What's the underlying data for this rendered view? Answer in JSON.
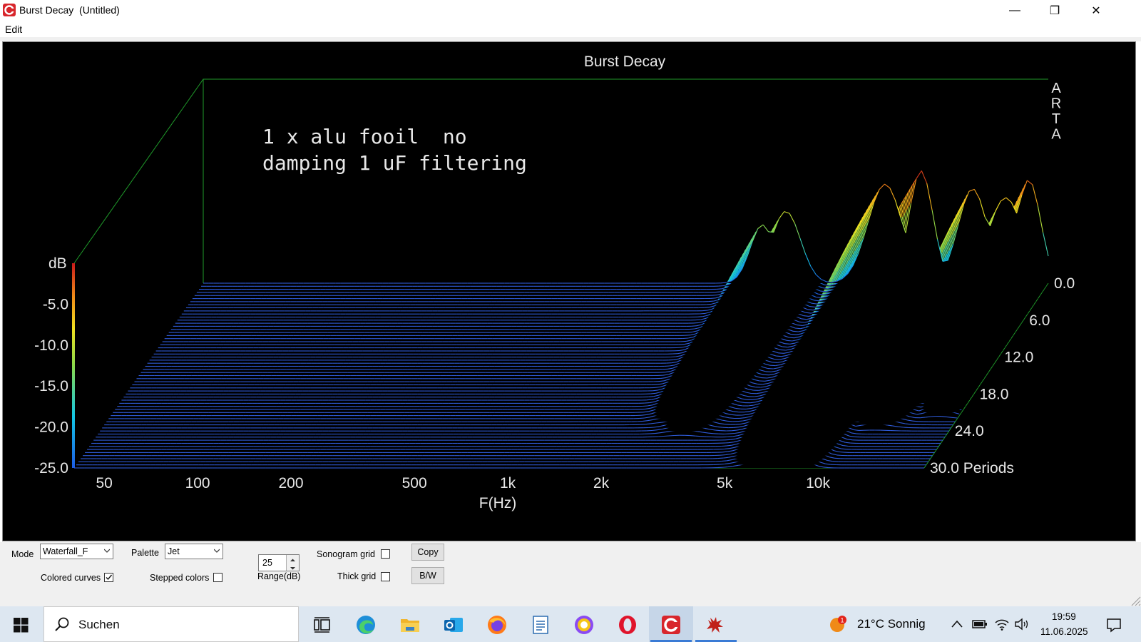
{
  "window": {
    "title": "Burst Decay  (Untitled)",
    "minimize": "—",
    "maximize": "❐",
    "close": "✕"
  },
  "menu": {
    "items": [
      "Edit"
    ]
  },
  "plot": {
    "title": "Burst Decay",
    "annotation_line1": "1 x alu fooil  no",
    "annotation_line2": "damping 1 uF filtering",
    "watermark": "ARTA",
    "db_label": "dB",
    "xlabel": "F(Hz)",
    "colors": {
      "background": "#000000",
      "baseline": "#2f5bd9",
      "grid": "#1f9a2a"
    }
  },
  "chart_data": {
    "type": "waterfall",
    "title": "Burst Decay",
    "xlabel": "F(Hz)",
    "ylabel": "dB",
    "x_scale": "log",
    "x_ticks": [
      "50",
      "100",
      "200",
      "500",
      "1k",
      "2k",
      "5k",
      "10k"
    ],
    "y_ticks": [
      "-5.0",
      "-10.0",
      "-15.0",
      "-20.0",
      "-25.0"
    ],
    "ylim": [
      -25,
      0
    ],
    "z_ticks": [
      "0.0",
      "6.0",
      "12.0",
      "18.0",
      "24.0",
      "30.0 Periods"
    ],
    "zlim": [
      0,
      30
    ],
    "palette": "Jet",
    "peaks": [
      {
        "freq_hz": 2600,
        "level_db": -12
      },
      {
        "freq_hz": 3100,
        "level_db": -9
      },
      {
        "freq_hz": 6500,
        "level_db": -3
      },
      {
        "freq_hz": 8500,
        "level_db": 0
      },
      {
        "freq_hz": 12500,
        "level_db": -4
      },
      {
        "freq_hz": 16000,
        "level_db": -6
      },
      {
        "freq_hz": 19000,
        "level_db": -2
      }
    ]
  },
  "controls": {
    "mode_label": "Mode",
    "mode_value": "Waterfall_F",
    "palette_label": "Palette",
    "palette_value": "Jet",
    "range_value": "25",
    "range_label": "Range(dB)",
    "sonogram_grid_label": "Sonogram grid",
    "sonogram_grid_checked": false,
    "colored_curves_label": "Colored curves",
    "colored_curves_checked": true,
    "stepped_colors_label": "Stepped colors",
    "stepped_colors_checked": false,
    "thick_grid_label": "Thick grid",
    "thick_grid_checked": false,
    "copy_button": "Copy",
    "bw_button": "B/W"
  },
  "taskbar": {
    "search_placeholder": "Suchen",
    "weather": "21°C  Sonnig",
    "weather_badge": "1",
    "time": "19:59",
    "date": "11.06.2025",
    "icons": [
      "task-view-icon",
      "edge-icon",
      "file-explorer-icon",
      "outlook-icon",
      "firefox-icon",
      "wordpad-icon",
      "browser-icon",
      "opera-icon",
      "arta-icon",
      "spider-app-icon"
    ]
  }
}
